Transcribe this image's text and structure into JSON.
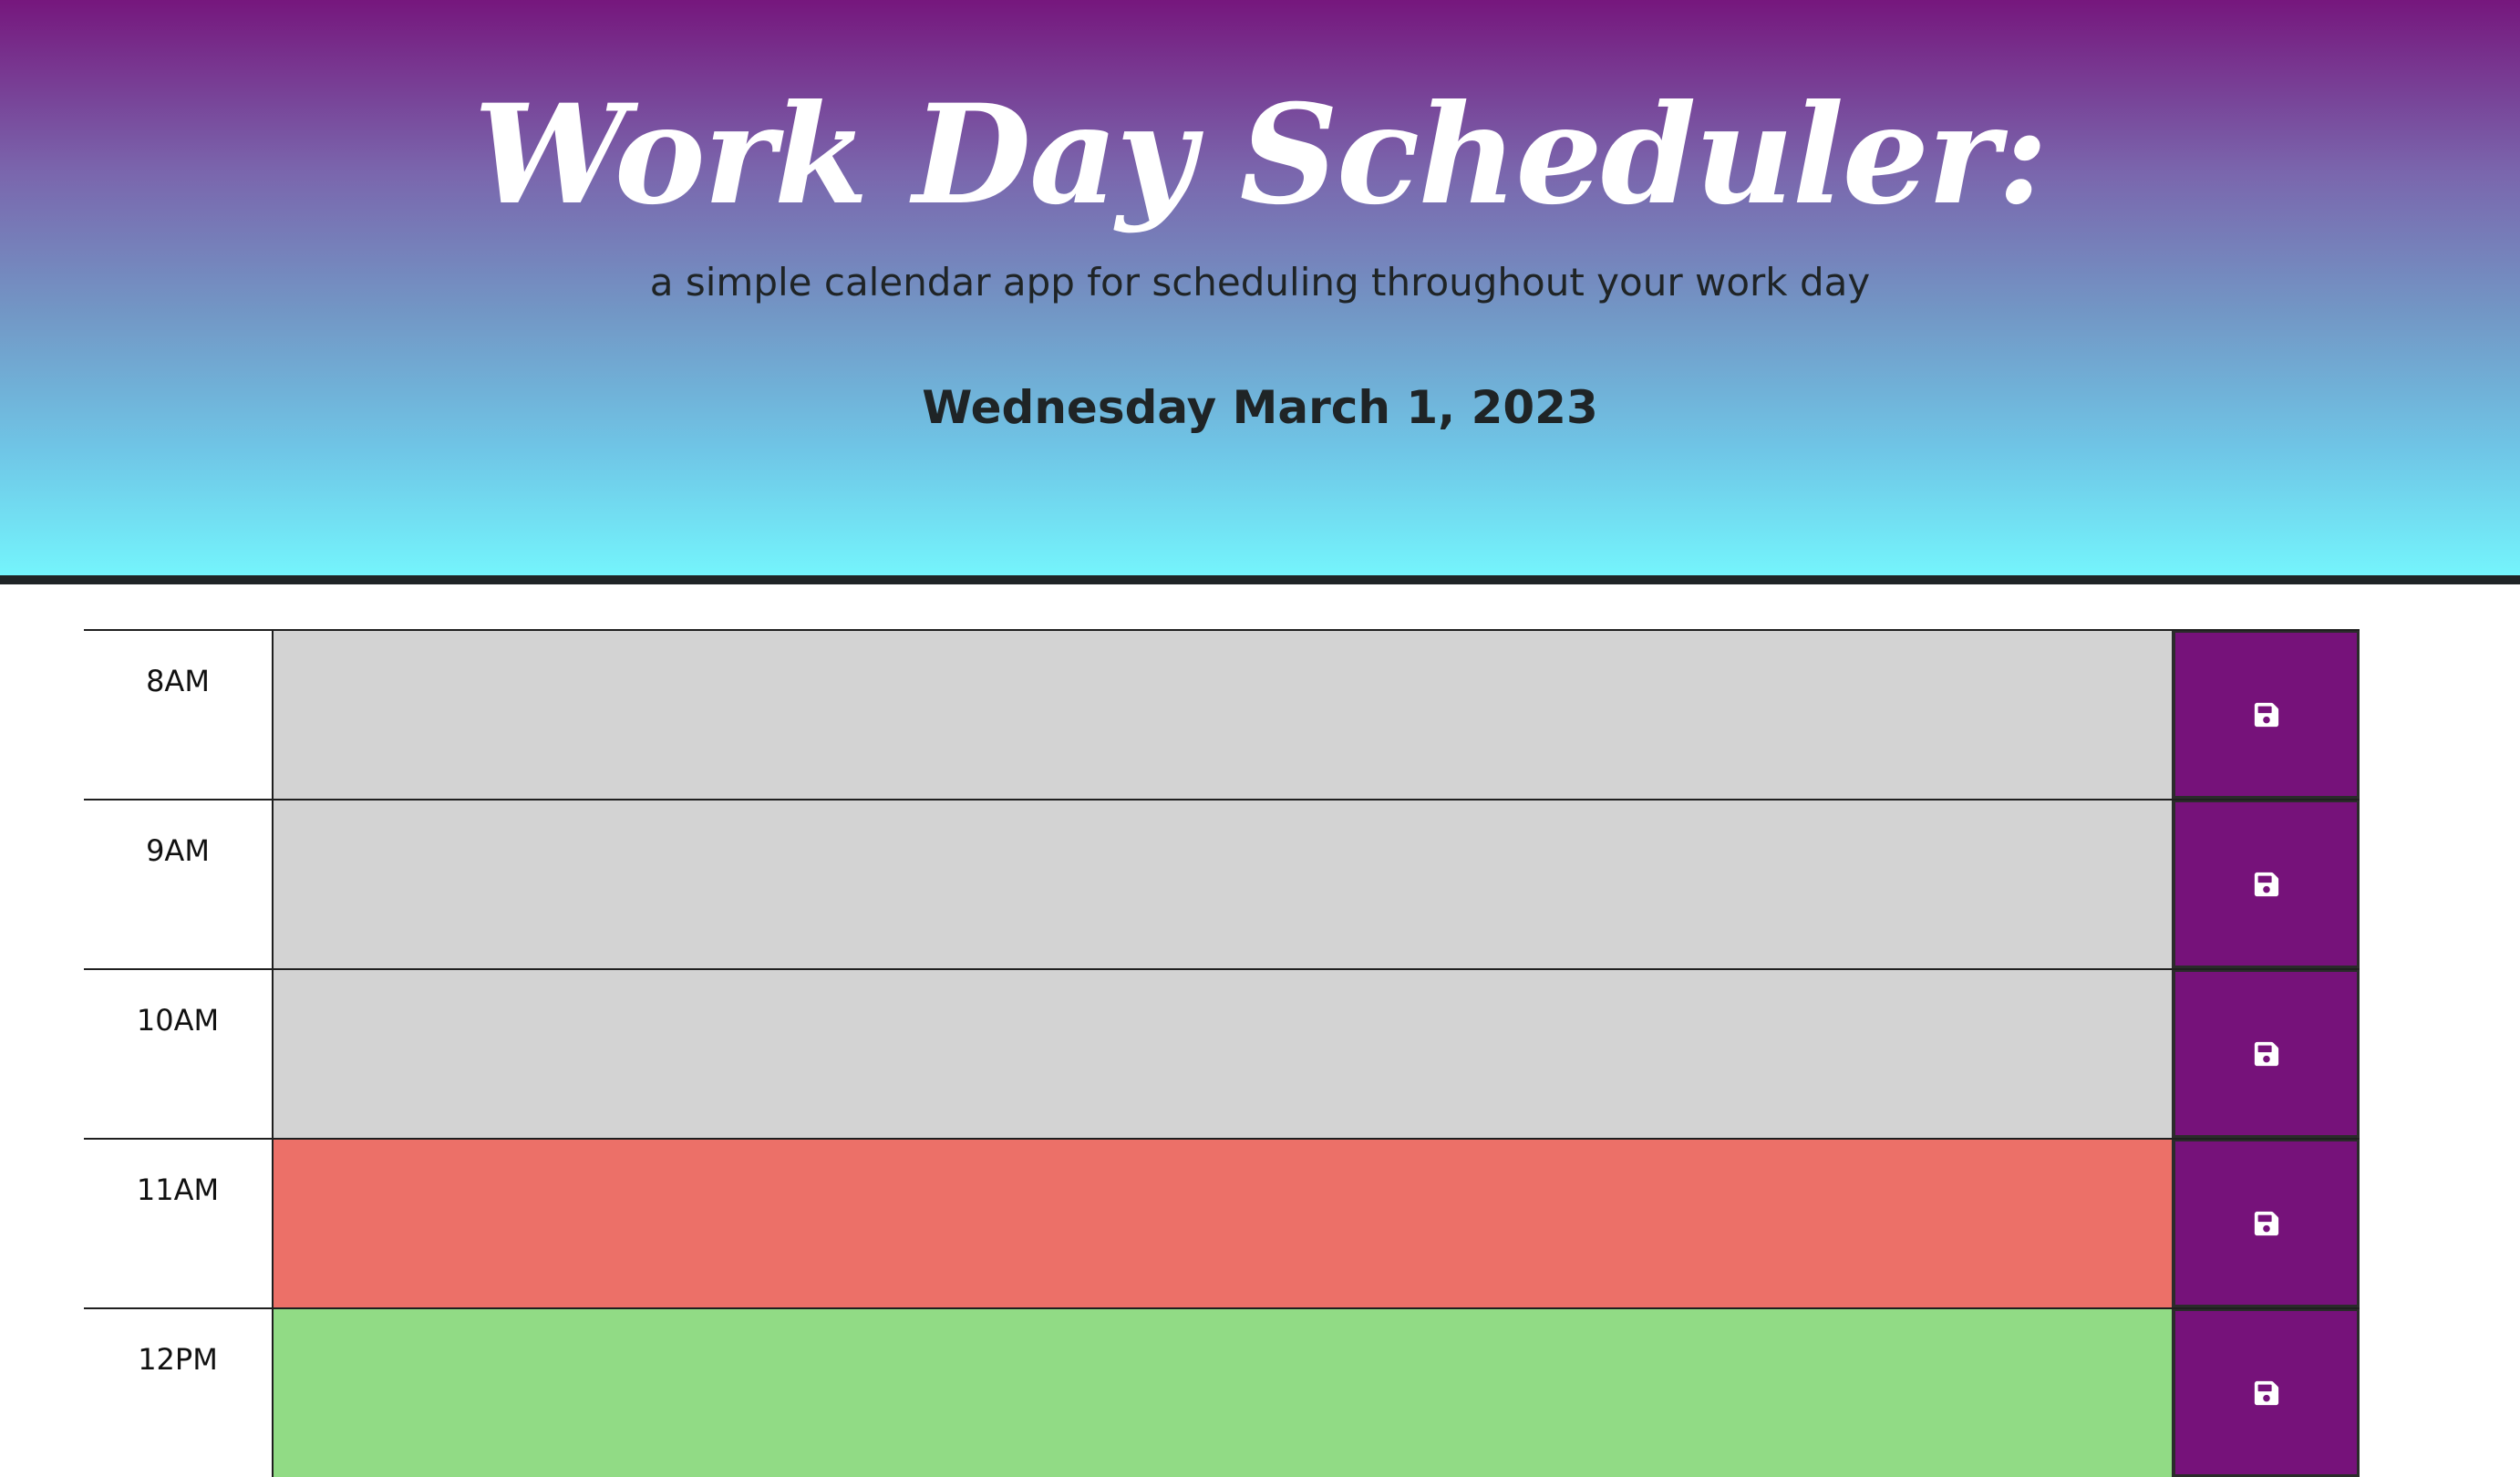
{
  "header": {
    "title": "Work Day Scheduler:",
    "subtitle": "a simple calendar app for scheduling throughout your work day",
    "current_day": "Wednesday March 1, 2023"
  },
  "colors": {
    "past": "#d3d3d3",
    "present": "#ec7068",
    "future": "#91db85",
    "save_button": "#76127a",
    "gradient_top": "#76177d",
    "gradient_bottom": "#74f4fc"
  },
  "time_blocks": [
    {
      "hour": "8AM",
      "status": "past",
      "text": "",
      "save_icon": "floppy-disk-icon"
    },
    {
      "hour": "9AM",
      "status": "past",
      "text": "",
      "save_icon": "floppy-disk-icon"
    },
    {
      "hour": "10AM",
      "status": "past",
      "text": "",
      "save_icon": "floppy-disk-icon"
    },
    {
      "hour": "11AM",
      "status": "present",
      "text": "",
      "save_icon": "floppy-disk-icon"
    },
    {
      "hour": "12PM",
      "status": "future",
      "text": "",
      "save_icon": "floppy-disk-icon"
    }
  ]
}
